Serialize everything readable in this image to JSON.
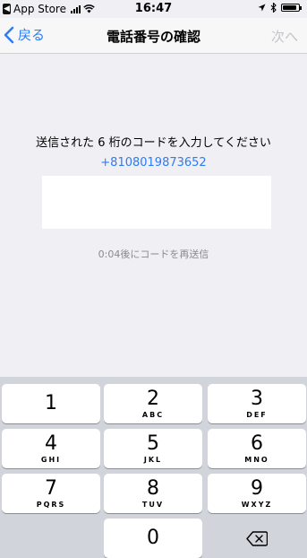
{
  "status_bar": {
    "back_app": "App Store",
    "time": "16:47"
  },
  "nav": {
    "back_label": "戻る",
    "title": "電話番号の確認",
    "next_label": "次へ"
  },
  "content": {
    "instruction": "送信された 6 桁のコードを入力してください",
    "phone_number": "+8108019873652",
    "code_value": "",
    "resend_text": "0:04後にコードを再送信"
  },
  "keypad": {
    "keys": [
      {
        "num": "1",
        "letters": ""
      },
      {
        "num": "2",
        "letters": "ABC"
      },
      {
        "num": "3",
        "letters": "DEF"
      },
      {
        "num": "4",
        "letters": "GHI"
      },
      {
        "num": "5",
        "letters": "JKL"
      },
      {
        "num": "6",
        "letters": "MNO"
      },
      {
        "num": "7",
        "letters": "PQRS"
      },
      {
        "num": "8",
        "letters": "TUV"
      },
      {
        "num": "9",
        "letters": "WXYZ"
      },
      {
        "num": "0",
        "letters": ""
      }
    ],
    "delete_icon": "backspace-icon"
  },
  "colors": {
    "accent": "#2c7cf6",
    "background": "#efeff4",
    "keypad_bg": "#d1d5db",
    "disabled": "#c4c4c8"
  }
}
